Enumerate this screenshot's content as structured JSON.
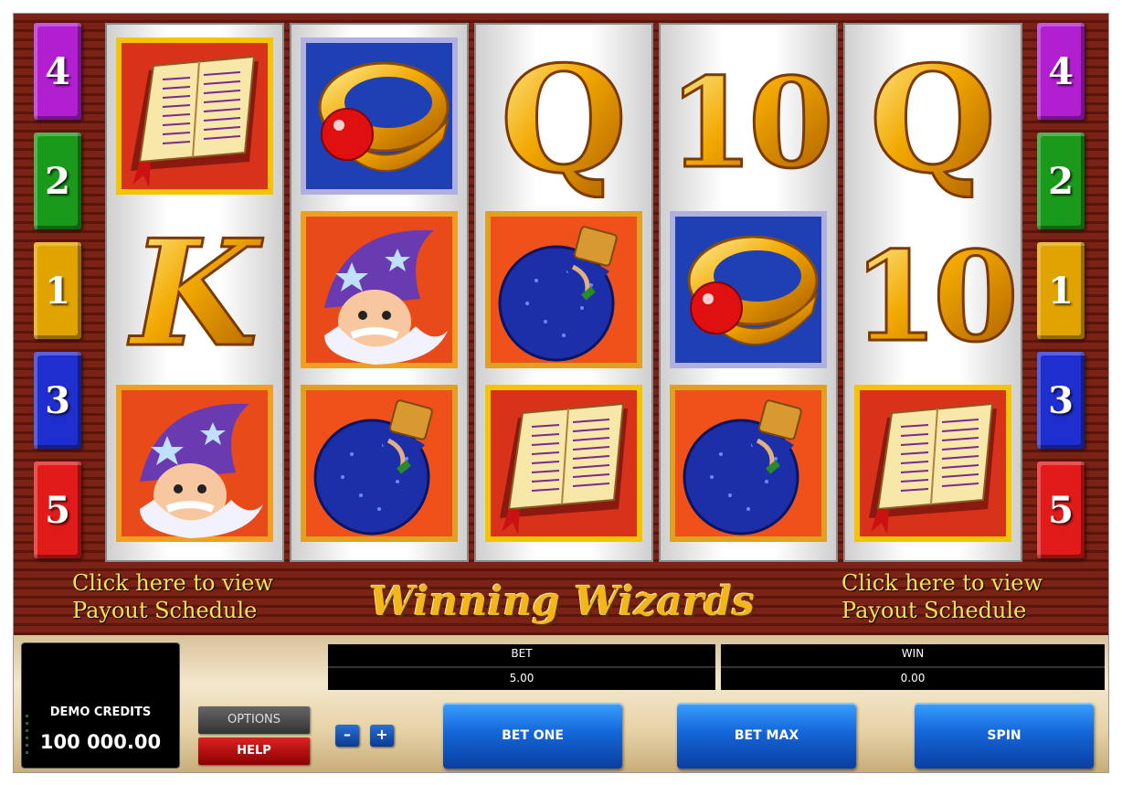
{
  "game": {
    "title": "Winning Wizards",
    "payout_link_left": [
      "Click here to view",
      "Payout Schedule"
    ],
    "payout_link_right": [
      "Click here to view",
      "Payout Schedule"
    ]
  },
  "paylines": {
    "left": [
      {
        "label": "4",
        "color": "#b21fd1"
      },
      {
        "label": "2",
        "color": "#1a9a1a"
      },
      {
        "label": "1",
        "color": "#e0a300"
      },
      {
        "label": "3",
        "color": "#1f2fcf"
      },
      {
        "label": "5",
        "color": "#e11a1a"
      }
    ],
    "right": [
      {
        "label": "4",
        "color": "#b21fd1"
      },
      {
        "label": "2",
        "color": "#1a9a1a"
      },
      {
        "label": "1",
        "color": "#e0a300"
      },
      {
        "label": "3",
        "color": "#1f2fcf"
      },
      {
        "label": "5",
        "color": "#e11a1a"
      }
    ]
  },
  "reels": [
    [
      "book",
      "letter-K",
      "wizard"
    ],
    [
      "ring",
      "wizard",
      "potion"
    ],
    [
      "letter-Q",
      "potion",
      "book"
    ],
    [
      "letter-10",
      "ring",
      "potion"
    ],
    [
      "letter-Q",
      "letter-10",
      "book"
    ]
  ],
  "panel": {
    "credits_label": "DEMO CREDITS",
    "credits_value": "100 000.00",
    "options_label": "OPTIONS",
    "help_label": "HELP",
    "minus_label": "–",
    "plus_label": "+",
    "bet_label": "BET",
    "bet_value": "5.00",
    "win_label": "WIN",
    "win_value": "0.00",
    "bet_one_label": "BET ONE",
    "bet_max_label": "BET MAX",
    "spin_label": "SPIN"
  }
}
